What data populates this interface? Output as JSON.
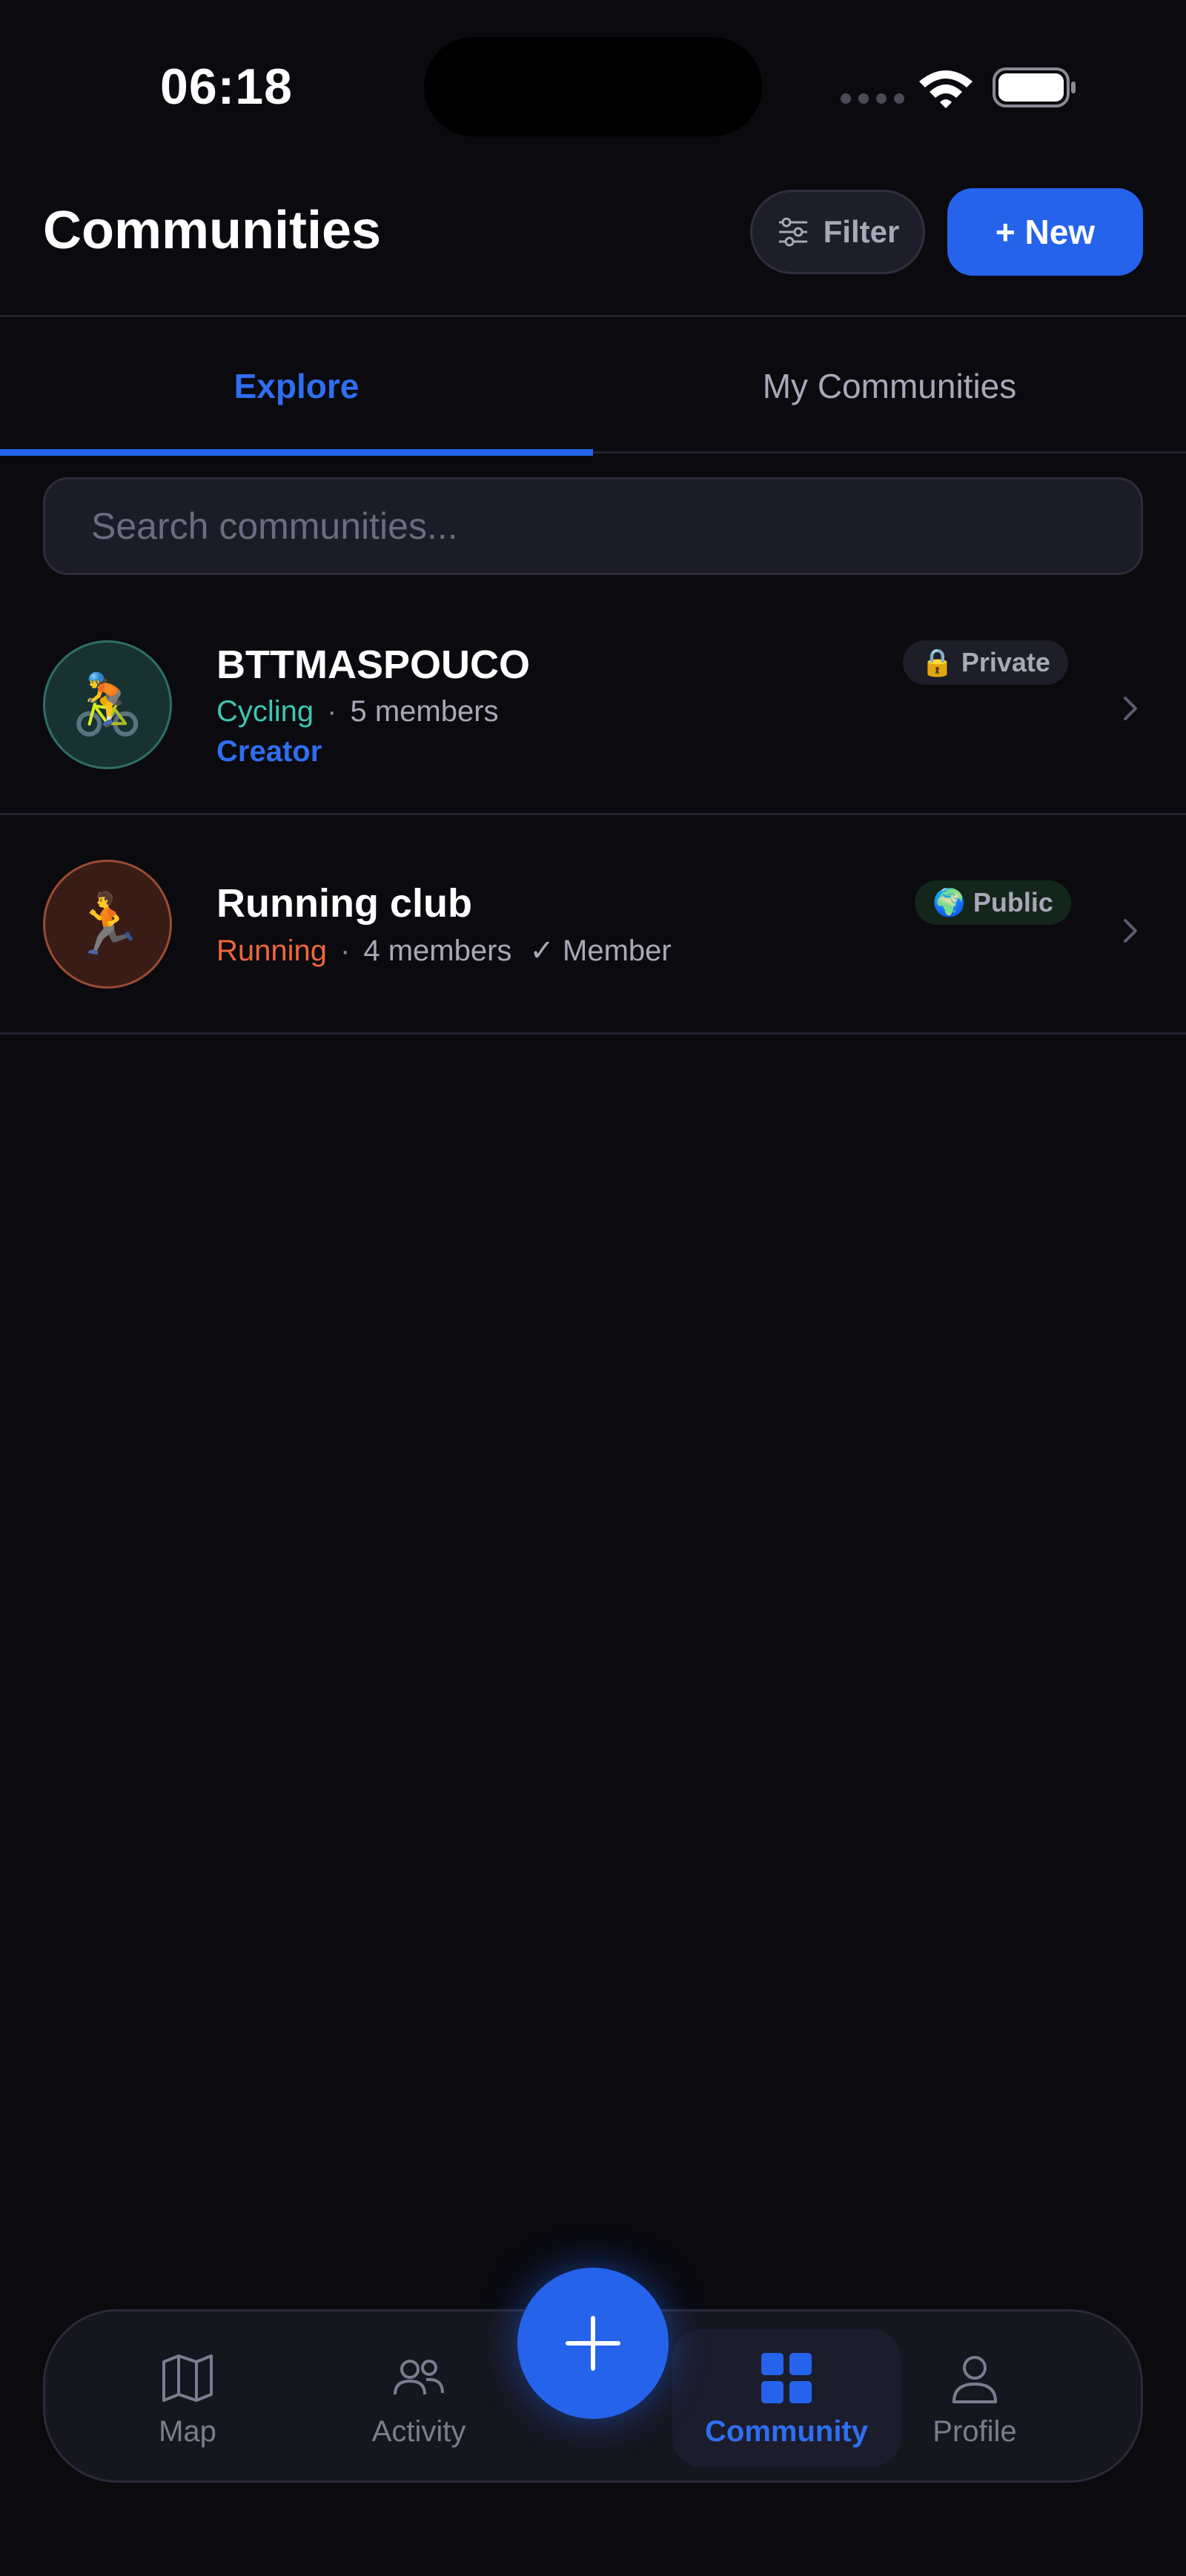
{
  "status_bar": {
    "time": "06:18",
    "icons": [
      "signal-dots-icon",
      "wifi-icon",
      "battery-icon"
    ]
  },
  "header": {
    "title": "Communities",
    "filter_label": "Filter",
    "new_label": "+ New"
  },
  "tabs": [
    {
      "label": "Explore",
      "active": true
    },
    {
      "label": "My Communities",
      "active": false
    }
  ],
  "search": {
    "placeholder": "Search communities...",
    "value": ""
  },
  "communities": [
    {
      "name": "BTTMASPOUCO",
      "sport": "Cycling",
      "members": "5 members",
      "role": "Creator",
      "privacy": "Private",
      "privacy_icon": "🔒",
      "avatar_emoji": "🚴"
    },
    {
      "name": "Running club",
      "sport": "Running",
      "members": "4 members",
      "membership": "✓ Member",
      "privacy": "Public",
      "privacy_icon": "🌍",
      "avatar_emoji": "🏃"
    }
  ],
  "separator": "·",
  "bottom_nav": {
    "items": [
      {
        "label": "Map",
        "icon": "map-icon"
      },
      {
        "label": "Activity",
        "icon": "people-icon"
      },
      {
        "label": "Community",
        "icon": "grid-icon",
        "active": true
      },
      {
        "label": "Profile",
        "icon": "person-icon"
      }
    ],
    "fab_icon": "plus-icon"
  },
  "colors": {
    "background": "#0a0a0f",
    "accent": "#2563eb",
    "cycling": "#3ec6b3",
    "running": "#f0673a",
    "muted_text": "#a8a8b8"
  }
}
